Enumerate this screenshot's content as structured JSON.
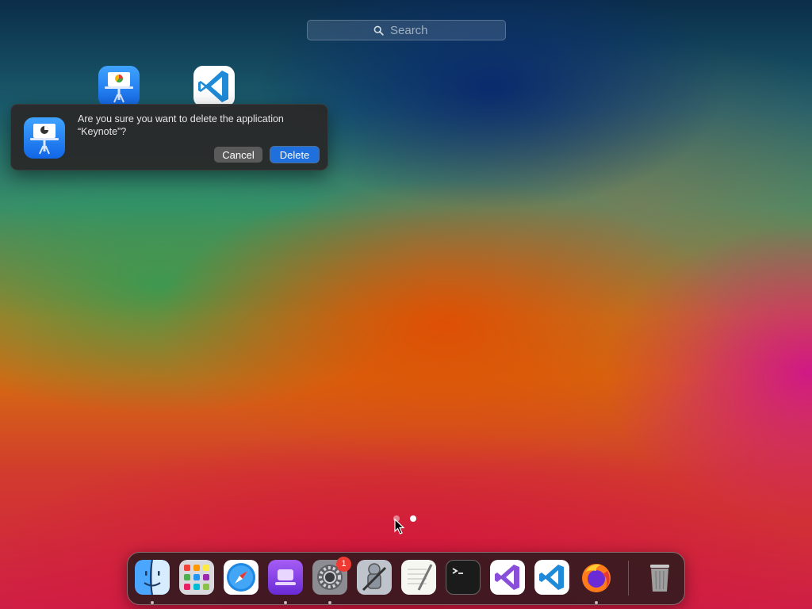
{
  "search": {
    "placeholder": "Search",
    "icon": "search-icon"
  },
  "launchpad": {
    "apps": [
      {
        "name": "Keynote",
        "icon": "keynote-icon"
      },
      {
        "name": "Visual Studio Code",
        "icon": "vscode-icon"
      }
    ]
  },
  "dialog": {
    "message": "Are you sure you want to delete the application “Keynote”?",
    "cancel_label": "Cancel",
    "delete_label": "Delete",
    "icon": "keynote-icon"
  },
  "dock": {
    "items": [
      {
        "icon": "finder-icon",
        "running": true
      },
      {
        "icon": "launchpad-icon",
        "running": false
      },
      {
        "icon": "safari-icon",
        "running": false
      },
      {
        "icon": "podcast-app-icon",
        "running": true
      },
      {
        "icon": "system-settings-icon",
        "running": true,
        "badge": "1"
      },
      {
        "icon": "automator-icon",
        "running": false
      },
      {
        "icon": "textedit-icon",
        "running": false
      },
      {
        "icon": "terminal-icon",
        "running": false
      },
      {
        "icon": "visual-studio-icon",
        "running": false
      },
      {
        "icon": "vscode-icon",
        "running": false
      },
      {
        "icon": "firefox-icon",
        "running": true
      },
      {
        "icon": "trash-icon",
        "running": false
      }
    ]
  },
  "colors": {
    "accent": "#1f6fdc",
    "dialog_bg": "#2a2a2a",
    "badge": "#ee3a33"
  },
  "pagination": {
    "current_page": 2,
    "total_pages": 2
  }
}
